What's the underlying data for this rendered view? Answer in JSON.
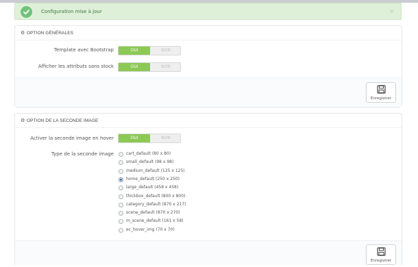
{
  "alert": {
    "message": "Configuration mise à jour",
    "close_label": "×"
  },
  "general_panel": {
    "title": "OPTION GÉNÉRALES",
    "rows": [
      {
        "label": "Template avec Bootstrap",
        "on_label": "OUI",
        "off_label": "NON",
        "value": "OUI"
      },
      {
        "label": "Afficher les attributs sans stock",
        "on_label": "OUI",
        "off_label": "NON",
        "value": "OUI"
      }
    ],
    "save_label": "Enregistrer"
  },
  "second_image_panel": {
    "title": "OPTION DE LA SECONDE IMAGE",
    "hover": {
      "label": "Activer la seconde image en hover",
      "on_label": "OUI",
      "off_label": "NON",
      "value": "OUI"
    },
    "type_label": "Type de la seconde image",
    "options": [
      "cart_default (80 x 80)",
      "small_default (98 x 98)",
      "medium_default (125 x 125)",
      "home_default (250 x 250)",
      "large_default (458 x 458)",
      "thickbox_default (800 x 800)",
      "category_default (870 x 217)",
      "scene_default (870 x 270)",
      "m_scene_default (161 x 58)",
      "ec_hover_img (70 x 70)"
    ],
    "selected": "home_default (250 x 250)",
    "save_label": "Enregistrer"
  },
  "colors": {
    "success_bg": "#dff0d8",
    "switch_on": "#8bc954",
    "radio_checked": "#3b5f88"
  }
}
